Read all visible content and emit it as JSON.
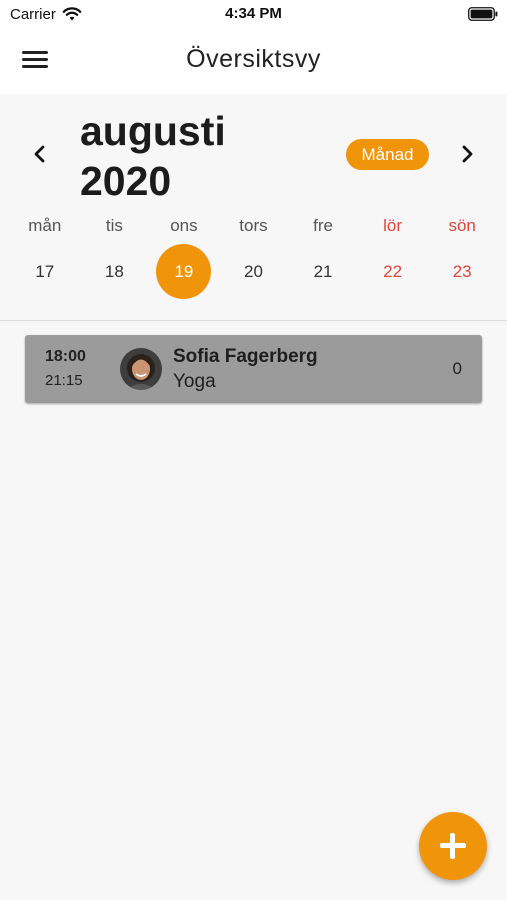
{
  "status_bar": {
    "carrier": "Carrier",
    "time": "4:34 PM"
  },
  "nav": {
    "title": "Översiktsvy",
    "menu_icon": "hamburger-icon"
  },
  "calendar": {
    "month": "augusti",
    "year": "2020",
    "view_toggle_label": "Månad",
    "prev_icon": "chevron-left-icon",
    "next_icon": "chevron-right-icon",
    "weekdays": [
      "mån",
      "tis",
      "ons",
      "tors",
      "fre",
      "lör",
      "sön"
    ],
    "dates": [
      "17",
      "18",
      "19",
      "20",
      "21",
      "22",
      "23"
    ],
    "selected_date": "19"
  },
  "events": [
    {
      "start": "18:00",
      "end": "21:15",
      "instructor": "Sofia Fagerberg",
      "activity": "Yoga",
      "count": "0"
    }
  ],
  "fab": {
    "icon": "plus-icon"
  },
  "colors": {
    "accent": "#f0940a",
    "weekend": "#e0453a",
    "card": "#9b9b9b",
    "background": "#f7f7f7"
  }
}
